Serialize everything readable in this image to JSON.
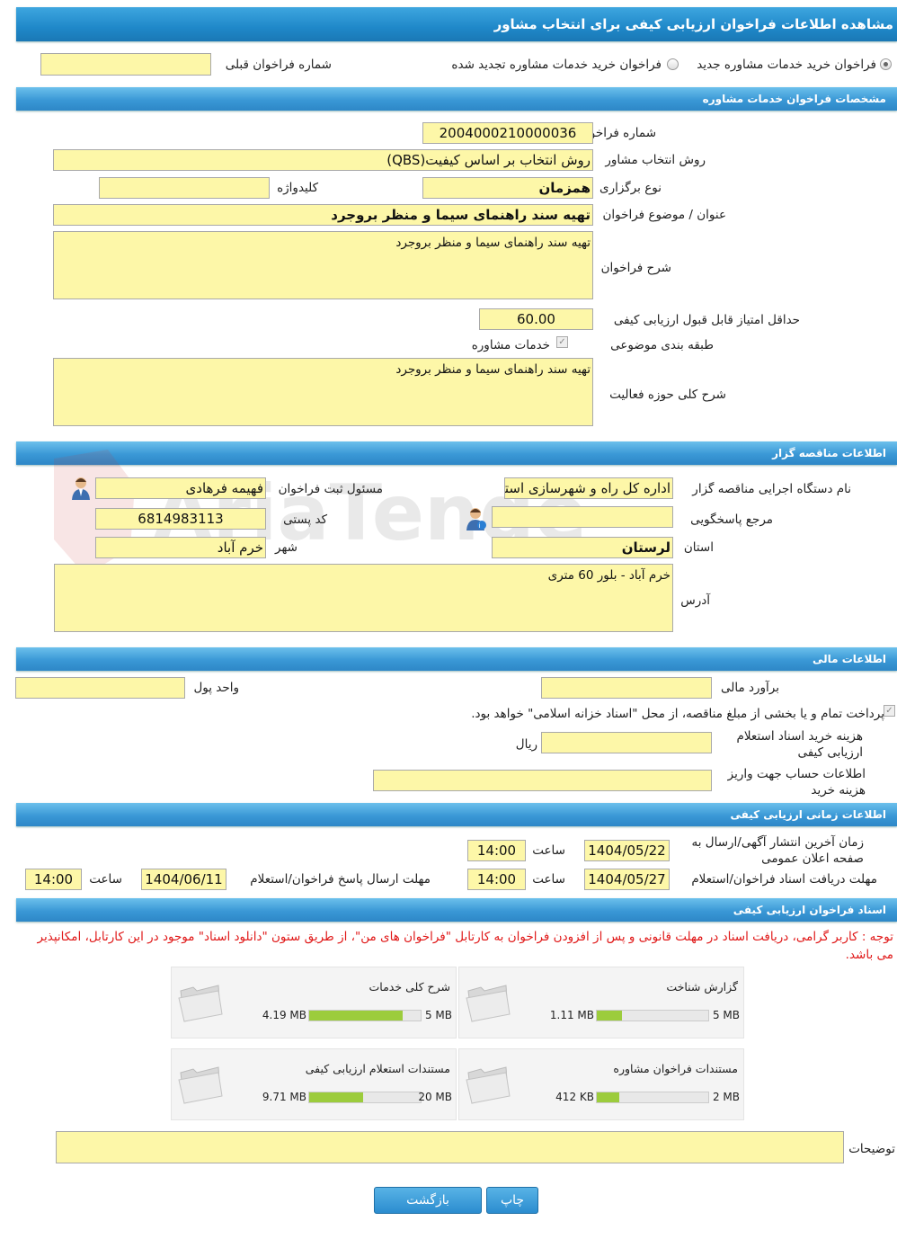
{
  "page": {
    "title": "مشاهده اطلاعات فراخوان ارزیابی کیفی برای انتخاب مشاور"
  },
  "top": {
    "radio_new": "فراخوان خرید خدمات مشاوره جدید",
    "radio_renew": "فراخوان خرید خدمات مشاوره تجدید شده",
    "prev_number_label": "شماره فراخوان قبلی",
    "prev_number_value": ""
  },
  "sections": {
    "consulting": "مشخصات فراخوان خدمات مشاوره",
    "tenderer": "اطلاعات مناقصه گزار",
    "financial": "اطلاعات مالی",
    "timing": "اطلاعات زمانی ارزیابی کیفی",
    "documents": "اسناد فراخوان ارزیابی کیفی"
  },
  "consulting": {
    "number_label": "شماره فراخوان",
    "number_value": "2004000210000036",
    "method_label": "روش انتخاب مشاور",
    "method_value": "روش انتخاب بر اساس کیفیت(QBS)",
    "type_label": "نوع برگزاری",
    "type_value": "همزمان",
    "keyword_label": "کلیدواژه",
    "keyword_value": "",
    "subject_label": "عنوان / موضوع فراخوان",
    "subject_value": "تهیه سند راهنمای سیما و منظر بروجرد",
    "desc_label": "شرح فراخوان",
    "desc_value": "تهیه سند راهنمای سیما و منظر بروجرد",
    "min_score_label": "حداقل امتیاز قابل قبول ارزیابی کیفی",
    "min_score_value": "60.00",
    "category_label": "طبقه بندی موضوعی",
    "category_value": "خدمات مشاوره",
    "scope_label": "شرح کلی حوزه فعالیت",
    "scope_value": "تهیه سند راهنمای سیما و منظر بروجرد"
  },
  "tenderer": {
    "org_label": "نام دستگاه اجرایی مناقصه گزار",
    "org_value": "اداره کل راه و شهرسازی استان لرستان",
    "registrar_label": "مسئول ثبت فراخوان",
    "registrar_value": "فهیمه فرهادی",
    "ref_label": "مرجع پاسخگویی",
    "ref_value": "",
    "postal_label": "کد پستی",
    "postal_value": "6814983113",
    "province_label": "استان",
    "province_value": "لرستان",
    "city_label": "شهر",
    "city_value": "خرم آباد",
    "address_label": "آدرس",
    "address_value": "خرم آباد - بلور 60 متری"
  },
  "financial": {
    "estimate_label": "برآورد مالی",
    "estimate_value": "",
    "currency_label": "واحد پول",
    "currency_value": "",
    "treasury_text": "پرداخت تمام و یا بخشی از مبلغ مناقصه، از محل \"اسناد خزانه اسلامی\" خواهد بود.",
    "cost_label": "هزینه خرید اسناد استعلام ارزیابی کیفی",
    "cost_value": "",
    "cost_unit": "ریال",
    "account_label": "اطلاعات حساب جهت واریز هزینه خرید",
    "account_value": ""
  },
  "timing": {
    "publish_label": "زمان آخرین انتشار آگهی/ارسال به صفحه اعلان عمومی",
    "publish_date": "1404/05/22",
    "publish_time": "14:00",
    "receive_label": "مهلت دریافت اسناد فراخوان/استعلام",
    "receive_date": "1404/05/27",
    "receive_time": "14:00",
    "reply_label": "مهلت ارسال پاسخ فراخوان/استعلام",
    "reply_date": "1404/06/11",
    "reply_time": "14:00",
    "time_label": "ساعت"
  },
  "documents": {
    "note": "توجه : کاربر گرامی، دریافت اسناد در مهلت قانونی و پس از افزودن فراخوان به کارتابل \"فراخوان های من\"، از طریق ستون \"دانلود اسناد\" موجود در این کارتابل، امکانپذیر می باشد.",
    "files": [
      {
        "title": "گزارش شناخت",
        "used": "1.11 MB",
        "total": "5 MB",
        "fraction": 0.222
      },
      {
        "title": "شرح کلی خدمات",
        "used": "4.19 MB",
        "total": "5 MB",
        "fraction": 0.838
      },
      {
        "title": "مستندات فراخوان مشاوره",
        "used": "412 KB",
        "total": "2 MB",
        "fraction": 0.201
      },
      {
        "title": "مستندات استعلام ارزیابی کیفی",
        "used": "9.71 MB",
        "total": "20 MB",
        "fraction": 0.4855
      }
    ],
    "notes_label": "توضیحات",
    "notes_value": ""
  },
  "buttons": {
    "print": "چاپ",
    "back": "بازگشت"
  },
  "watermark": "AriaTender.net",
  "colors": {
    "field_bg": "#fdf7a8",
    "header_blue": "#2d87c7",
    "progress_green": "#9ccc3c",
    "note_red": "#e01818"
  }
}
